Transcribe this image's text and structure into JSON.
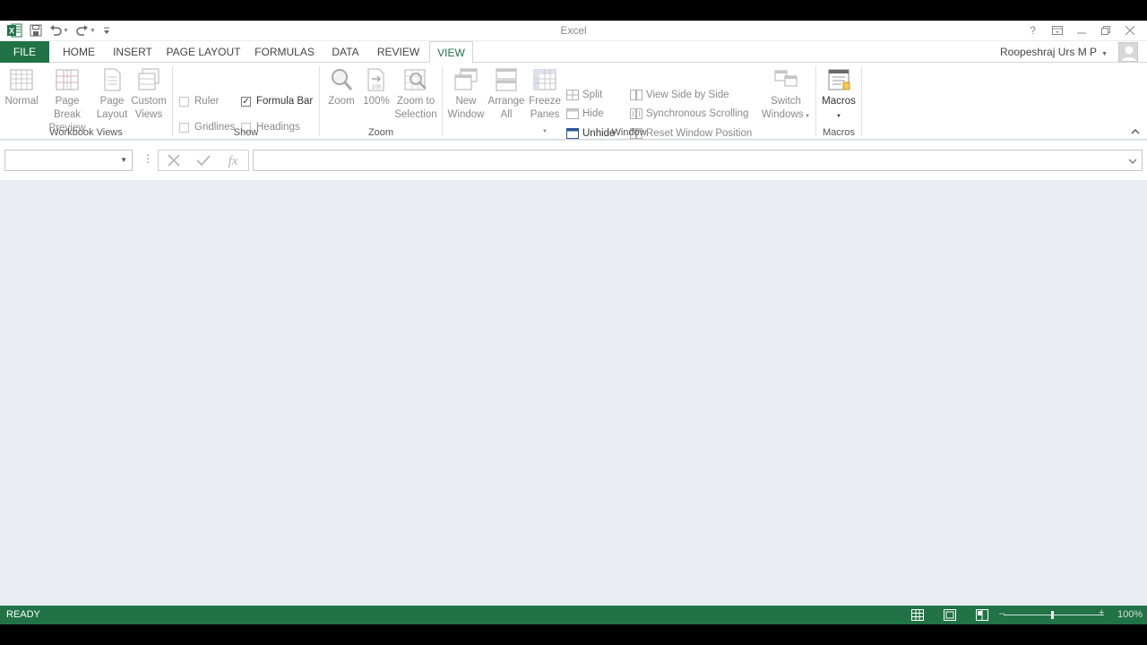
{
  "app": {
    "title": "Excel",
    "user": "Roopeshraj Urs M P",
    "brand_color": "#217346"
  },
  "qat": {
    "icons": [
      "excel-logo-icon",
      "save-icon",
      "undo-icon",
      "redo-icon",
      "customize-qat-icon"
    ]
  },
  "window_controls": [
    "?",
    "❒",
    "—",
    "❐",
    "✕"
  ],
  "tabs": [
    {
      "label": "FILE"
    },
    {
      "label": "HOME"
    },
    {
      "label": "INSERT"
    },
    {
      "label": "PAGE LAYOUT"
    },
    {
      "label": "FORMULAS"
    },
    {
      "label": "DATA"
    },
    {
      "label": "REVIEW"
    },
    {
      "label": "VIEW",
      "active": true
    }
  ],
  "ribbon": {
    "workbook_views": {
      "label": "Workbook Views",
      "normal": "Normal",
      "page_break_1": "Page Break",
      "page_break_2": "Preview",
      "page_layout_1": "Page",
      "page_layout_2": "Layout",
      "custom_views_1": "Custom",
      "custom_views_2": "Views"
    },
    "show": {
      "label": "Show",
      "ruler": "Ruler",
      "formula_bar": "Formula Bar",
      "gridlines": "Gridlines",
      "headings": "Headings"
    },
    "zoom": {
      "label": "Zoom",
      "zoom": "Zoom",
      "hundred": "100%",
      "zoom_sel_1": "Zoom to",
      "zoom_sel_2": "Selection"
    },
    "window": {
      "label": "Window",
      "new_1": "New",
      "new_2": "Window",
      "arrange_1": "Arrange",
      "arrange_2": "All",
      "freeze_1": "Freeze",
      "freeze_2": "Panes",
      "split": "Split",
      "hide": "Hide",
      "unhide": "Unhide",
      "side_by_side": "View Side by Side",
      "sync_scroll": "Synchronous Scrolling",
      "reset_pos": "Reset Window Position",
      "switch_1": "Switch",
      "switch_2": "Windows"
    },
    "macros": {
      "label": "Macros",
      "macros": "Macros"
    }
  },
  "status": {
    "text": "READY",
    "zoom_level": "100%"
  }
}
